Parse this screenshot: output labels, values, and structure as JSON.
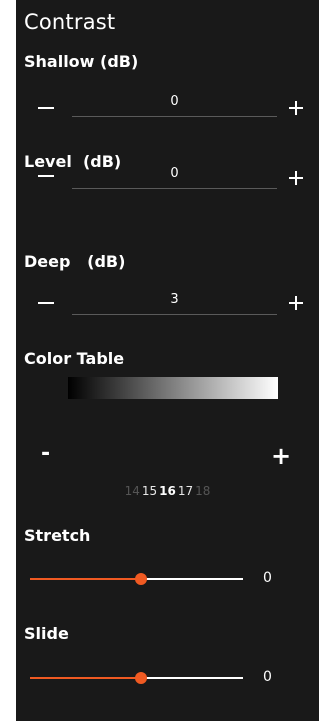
{
  "panel": {
    "title": "Contrast"
  },
  "shallow": {
    "label": "Shallow (dB)",
    "value": "0"
  },
  "level": {
    "label": "Level  (dB)",
    "value": "0"
  },
  "deep": {
    "label": "Deep   (dB)",
    "value": "3"
  },
  "color_table": {
    "label": "Color Table",
    "gradient_from": "#000000",
    "gradient_to": "#ffffff",
    "minus_label": "-",
    "plus_label": "+",
    "pages": [
      "14",
      "15",
      "16",
      "17",
      "18"
    ],
    "current_page": "16"
  },
  "stretch": {
    "label": "Stretch",
    "value": "0",
    "level_fraction": 0.52
  },
  "slide": {
    "label": "Slide",
    "value": "0",
    "level_fraction": 0.52
  },
  "colors": {
    "background": "#191919",
    "accent": "#f05a22",
    "text": "#ffffff"
  }
}
